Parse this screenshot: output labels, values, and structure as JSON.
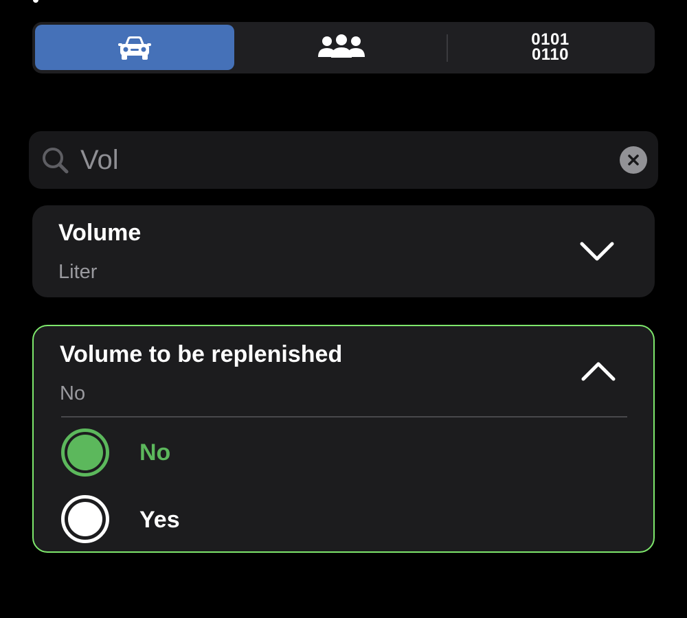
{
  "segmented_control": {
    "segments": [
      {
        "icon": "car-icon",
        "selected": true
      },
      {
        "icon": "group-icon",
        "selected": false
      },
      {
        "icon": "binary-icon",
        "text_line1": "0101",
        "text_line2": "0110",
        "selected": false
      }
    ],
    "selected_color": "#4571b8"
  },
  "search": {
    "value": "Vol",
    "icon": "search-icon",
    "clear_icon": "clear-icon"
  },
  "results": [
    {
      "title": "Volume",
      "subtitle": "Liter",
      "expanded": false,
      "chevron_icon": "chevron-down-icon"
    },
    {
      "title": "Volume to be replenished",
      "subtitle": "No",
      "expanded": true,
      "chevron_icon": "chevron-up-icon",
      "border_color": "#7ee86c",
      "options": [
        {
          "label": "No",
          "selected": true
        },
        {
          "label": "Yes",
          "selected": false
        }
      ],
      "selected_color": "#5cb85c"
    }
  ]
}
